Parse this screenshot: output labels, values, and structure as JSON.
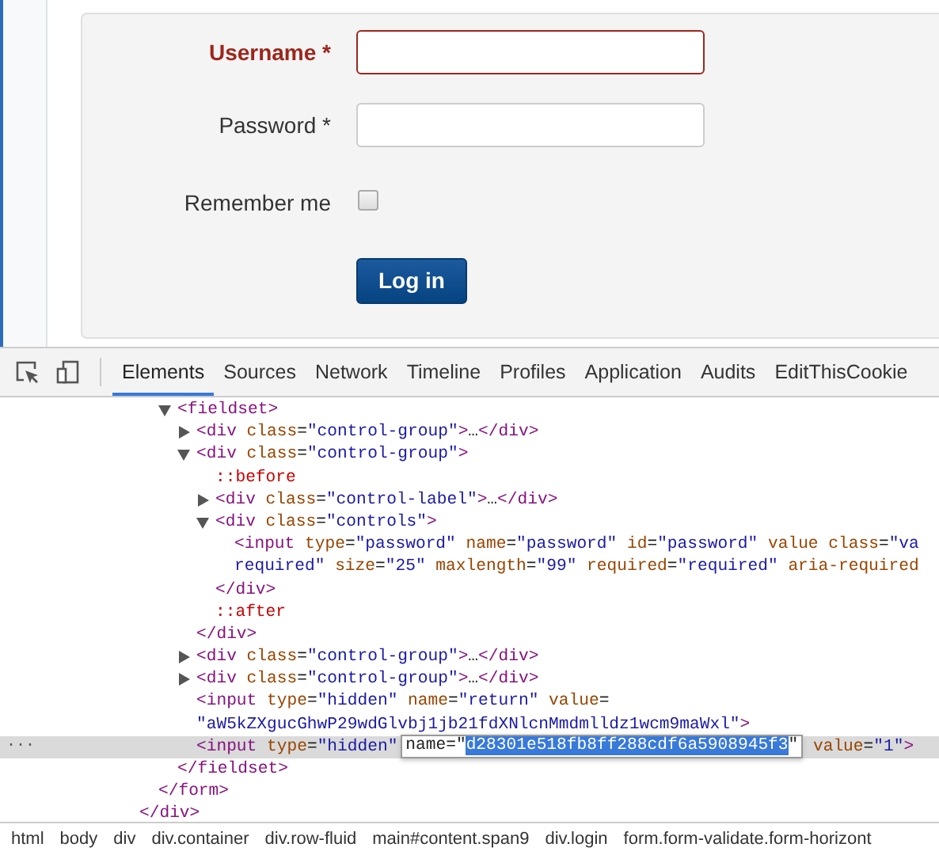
{
  "login_form": {
    "fields": [
      {
        "kind": "text",
        "label": "Username *",
        "invalid": true
      },
      {
        "kind": "password",
        "label": "Password *",
        "invalid": false
      },
      {
        "kind": "checkbox",
        "label": "Remember me",
        "checked": false
      }
    ],
    "submit_button": "Log in"
  },
  "devtools": {
    "tabs": [
      {
        "label": "Elements",
        "selected": true
      },
      {
        "label": "Sources",
        "selected": false
      },
      {
        "label": "Network",
        "selected": false
      },
      {
        "label": "Timeline",
        "selected": false
      },
      {
        "label": "Profiles",
        "selected": false
      },
      {
        "label": "Application",
        "selected": false
      },
      {
        "label": "Audits",
        "selected": false
      },
      {
        "label": "EditThisCookie",
        "selected": false
      }
    ],
    "dom_tree": [
      {
        "kind": "element",
        "selected": false,
        "close": "</div>",
        "children": [
          {
            "kind": "element",
            "selected": false,
            "close": "</form>",
            "children": [
              {
                "kind": "element",
                "open": [
                  "<fieldset>"
                ],
                "expanded": true,
                "selected": false,
                "close": "</fieldset>",
                "children": [
                  {
                    "kind": "element",
                    "open": [
                      "<div class=\"control-group\">…</div>"
                    ],
                    "expanded": false,
                    "selected": false
                  },
                  {
                    "kind": "element",
                    "open": [
                      "<div class=\"control-group\">"
                    ],
                    "expanded": true,
                    "selected": false,
                    "close": "</div>",
                    "children": [
                      {
                        "kind": "pseudo",
                        "text": "::before",
                        "selected": false
                      },
                      {
                        "kind": "element",
                        "open": [
                          "<div class=\"control-label\">…</div>"
                        ],
                        "expanded": false,
                        "selected": false
                      },
                      {
                        "kind": "element",
                        "open": [
                          "<div class=\"controls\">"
                        ],
                        "expanded": true,
                        "selected": false,
                        "close": "</div>",
                        "children": [
                          {
                            "kind": "element",
                            "open": [
                              "<input type=\"password\" name=\"password\" id=\"password\" value class=\"va",
                              "required\" size=\"25\" maxlength=\"99\" required=\"required\" aria-required"
                            ],
                            "selected": false
                          }
                        ]
                      },
                      {
                        "kind": "pseudo",
                        "text": "::after",
                        "selected": false
                      }
                    ]
                  },
                  {
                    "kind": "element",
                    "open": [
                      "<div class=\"control-group\">…</div>"
                    ],
                    "expanded": false,
                    "selected": false
                  },
                  {
                    "kind": "element",
                    "open": [
                      "<div class=\"control-group\">…</div>"
                    ],
                    "expanded": false,
                    "selected": false
                  },
                  {
                    "kind": "element",
                    "open": [
                      "<input type=\"hidden\" name=\"return\" value=",
                      "\"aW5kZXgucGhwP29wdGlvbj1jb21fdXNlcnMmdmlldz1wcm9maWxl\">"
                    ],
                    "selected": false
                  },
                  {
                    "kind": "element",
                    "open": [
                      "<input type=\"hidden\""
                    ],
                    "edit": {
                      "before": "name=\"",
                      "selection": "d28301e518fb8ff288cdf6a5908945f3",
                      "after": "\""
                    },
                    "after": " value=\"1\">",
                    "selected": true,
                    "gutter_mark": "···"
                  }
                ]
              }
            ]
          }
        ]
      }
    ],
    "breadcrumbs": [
      "html",
      "body",
      "div",
      "div.container",
      "div.row-fluid",
      "main#content.span9",
      "div.login",
      "form.form-validate.form-horizont"
    ]
  }
}
